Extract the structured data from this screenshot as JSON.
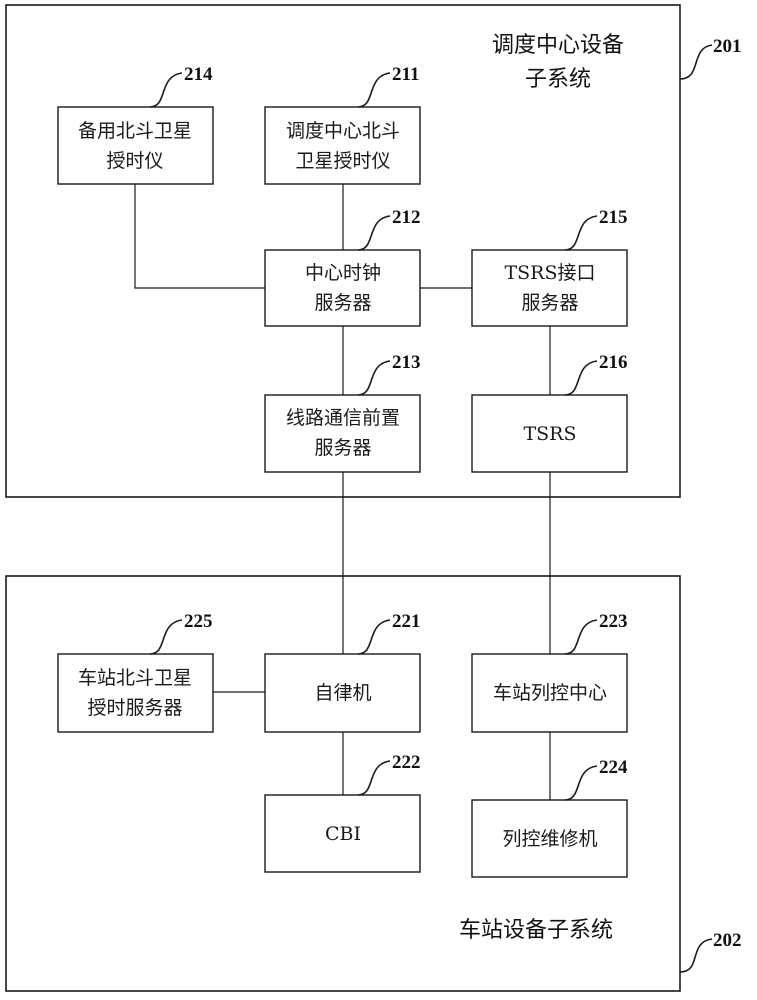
{
  "subsystems": [
    {
      "id": "201",
      "ref": "201",
      "title_lines": [
        "调度中心设备",
        "子系统"
      ]
    },
    {
      "id": "202",
      "ref": "202",
      "title_lines": [
        "车站设备子系统"
      ]
    }
  ],
  "nodes": {
    "n214": {
      "ref": "214",
      "lines": [
        "备用北斗卫星",
        "授时仪"
      ]
    },
    "n211": {
      "ref": "211",
      "lines": [
        "调度中心北斗",
        "卫星授时仪"
      ]
    },
    "n212": {
      "ref": "212",
      "lines": [
        "中心时钟",
        "服务器"
      ]
    },
    "n215": {
      "ref": "215",
      "lines": [
        "TSRS接口",
        "服务器"
      ]
    },
    "n213": {
      "ref": "213",
      "lines": [
        "线路通信前置",
        "服务器"
      ]
    },
    "n216": {
      "ref": "216",
      "lines": [
        "TSRS"
      ]
    },
    "n225": {
      "ref": "225",
      "lines": [
        "车站北斗卫星",
        "授时服务器"
      ]
    },
    "n221": {
      "ref": "221",
      "lines": [
        "自律机"
      ]
    },
    "n223": {
      "ref": "223",
      "lines": [
        "车站列控中心"
      ]
    },
    "n222": {
      "ref": "222",
      "lines": [
        "CBI"
      ]
    },
    "n224": {
      "ref": "224",
      "lines": [
        "列控维修机"
      ]
    }
  },
  "connections": [
    [
      "n214",
      "n212"
    ],
    [
      "n211",
      "n212"
    ],
    [
      "n212",
      "n215"
    ],
    [
      "n212",
      "n213"
    ],
    [
      "n215",
      "n216"
    ],
    [
      "n213",
      "n221"
    ],
    [
      "n216",
      "n223"
    ],
    [
      "n225",
      "n221"
    ],
    [
      "n221",
      "n222"
    ],
    [
      "n223",
      "n224"
    ]
  ]
}
